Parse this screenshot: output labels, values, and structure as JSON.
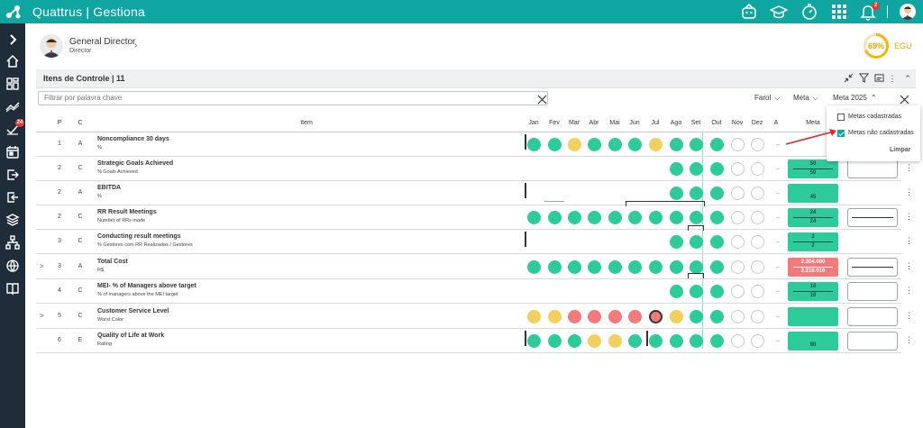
{
  "app": {
    "title": "Quattrus | Gestiona",
    "notification_count": "2"
  },
  "sidebar": {
    "badge_count": "24"
  },
  "profile": {
    "name": "General Director",
    "role": "Director"
  },
  "egu": {
    "percent": "69%",
    "label": "EGU"
  },
  "panel": {
    "title": "Itens de Controle | 11"
  },
  "filters": {
    "search_placeholder": "Filtrar por palavra chave",
    "farol": "Farol",
    "meta": "Meta",
    "meta_year": "Meta 2025"
  },
  "dropdown": {
    "option1": "Metas cadastradas",
    "option2": "Metas não cadastradas",
    "clear": "Limpar"
  },
  "table": {
    "headers": {
      "p": "P",
      "c": "C",
      "item": "Item",
      "a": "A",
      "meta": "Meta"
    },
    "months": [
      "Jan",
      "Fev",
      "Mar",
      "Abr",
      "Mai",
      "Jun",
      "Jul",
      "Ago",
      "Set",
      "Out",
      "Nov",
      "Dez"
    ],
    "rows": [
      {
        "p": "1",
        "c": "A",
        "name": "Noncompliance 30 days",
        "unit": "%",
        "expand": ""
      },
      {
        "p": "2",
        "c": "C",
        "name": "Strategic Goals Achieved",
        "unit": "% Goals Achieved",
        "expand": "",
        "meta_top": "50",
        "meta_bot": "50"
      },
      {
        "p": "2",
        "c": "A",
        "name": "EBITDA",
        "unit": "%",
        "expand": "",
        "meta_top": "",
        "meta_bot": "45"
      },
      {
        "p": "2",
        "c": "C",
        "name": "RR Result Meetings",
        "unit": "Number of RRs made",
        "expand": "",
        "meta_top": "24",
        "meta_bot": "24"
      },
      {
        "p": "3",
        "c": "C",
        "name": "Conducting result meetings",
        "unit": "% Gestores com RR Realizadas / Gestores",
        "expand": "",
        "meta_top": "2",
        "meta_bot": "2"
      },
      {
        "p": "3",
        "c": "A",
        "name": "Total Cost",
        "unit": "R$",
        "expand": ">",
        "meta_top": "2.304.000",
        "meta_bot": "2.216.016"
      },
      {
        "p": "4",
        "c": "C",
        "name": "MEI- % of Managers above target",
        "unit": "% of managers above the MEI target",
        "expand": "",
        "meta_top": "10",
        "meta_bot": "10"
      },
      {
        "p": "5",
        "c": "C",
        "name": "Customer Service Level",
        "unit": "Worst Color",
        "expand": ">",
        "meta_top": "",
        "meta_bot": ""
      },
      {
        "p": "6",
        "c": "E",
        "name": "Quality of Life at Work",
        "unit": "Rating",
        "expand": "",
        "meta_top": "",
        "meta_bot": "90"
      }
    ]
  },
  "colors": {
    "brand": "#0fa5a1",
    "green": "#2ecb9a",
    "yellow": "#f3cf60",
    "red": "#f27a7a",
    "sidebar": "#1f2d3a"
  },
  "icons": [
    "logo-icon",
    "reports-icon",
    "learning-icon",
    "timer-icon",
    "apps-grid-icon",
    "bell-icon",
    "user-avatar"
  ]
}
